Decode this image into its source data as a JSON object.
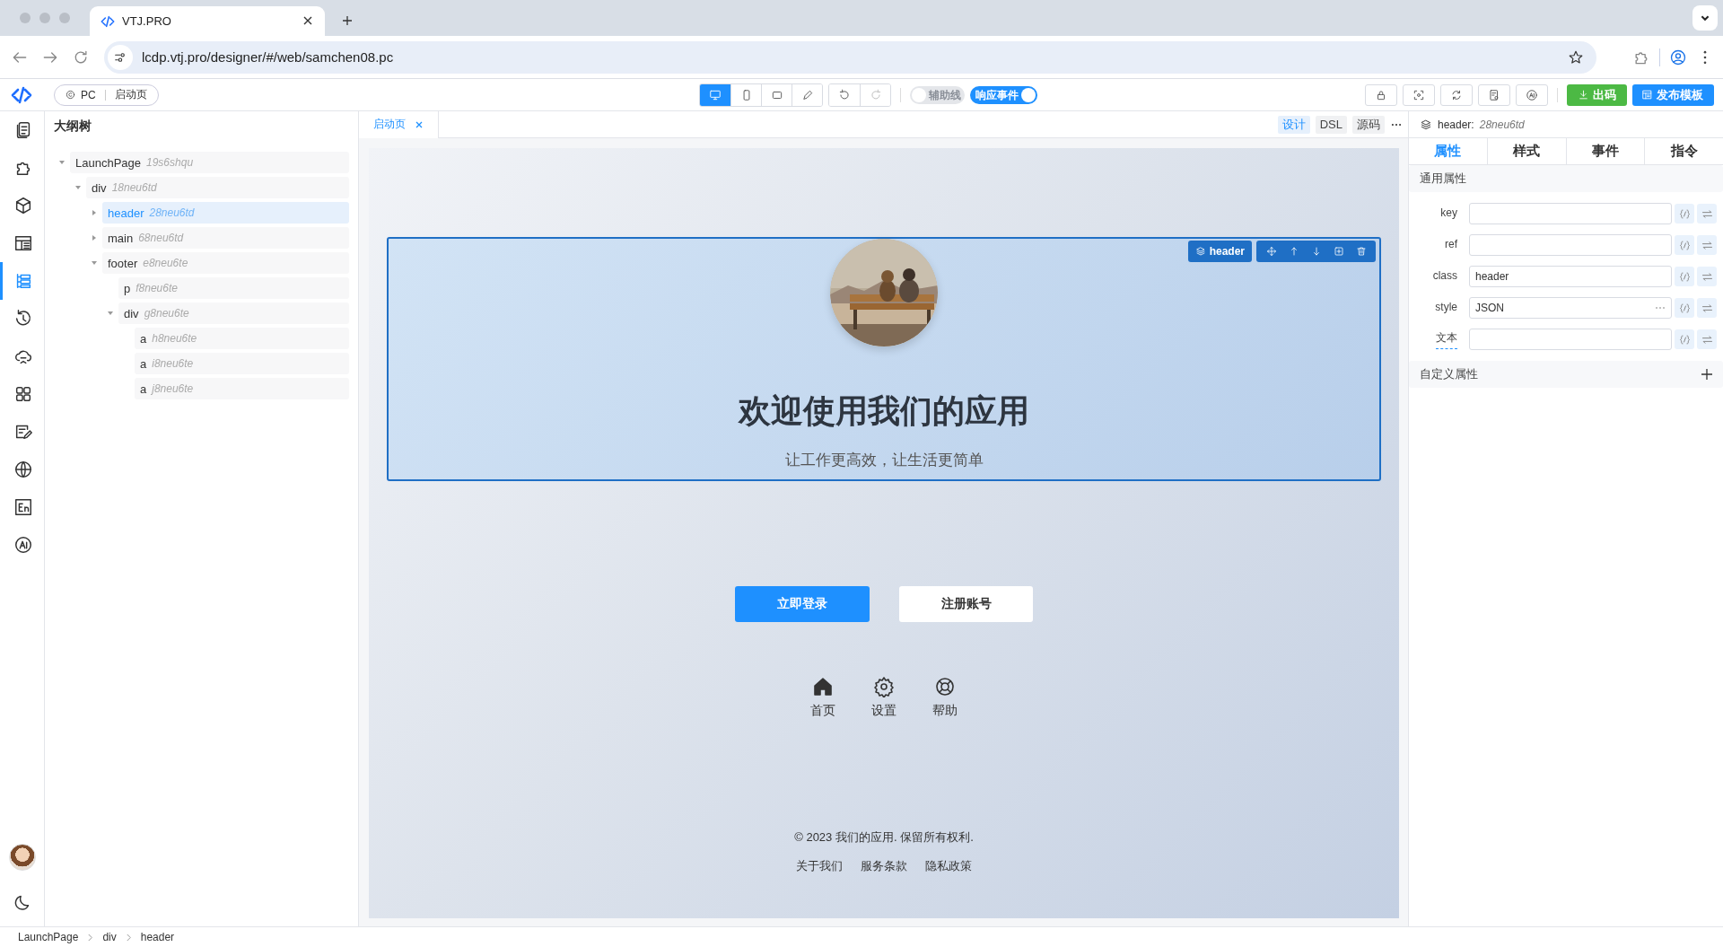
{
  "browser": {
    "tab_title": "VTJ.PRO",
    "url": "lcdp.vtj.pro/designer/#/web/samchen08.pc"
  },
  "toolbar": {
    "platform": "PC",
    "page": "启动页",
    "devices": [
      {
        "kind": "desktop",
        "selected": true
      },
      {
        "kind": "phone",
        "selected": false
      },
      {
        "kind": "tablet",
        "selected": false
      },
      {
        "kind": "pen",
        "selected": false
      }
    ],
    "history": [
      {
        "kind": "undo",
        "disabled": false
      },
      {
        "kind": "redo",
        "disabled": true
      }
    ],
    "toggles": [
      {
        "label": "辅助线",
        "on": false
      },
      {
        "label": "响应事件",
        "on": true
      }
    ],
    "tools": [
      {
        "kind": "lock"
      },
      {
        "kind": "preview"
      },
      {
        "kind": "refresh"
      },
      {
        "kind": "settings-doc"
      },
      {
        "kind": "ai"
      }
    ],
    "actions": [
      {
        "label": "出码",
        "kind": "export"
      },
      {
        "label": "发布模板",
        "kind": "publish"
      }
    ]
  },
  "sidebar": {
    "items": [
      {
        "kind": "pages",
        "selected": false
      },
      {
        "kind": "plugin",
        "selected": false
      },
      {
        "kind": "component",
        "selected": false
      },
      {
        "kind": "template",
        "selected": false
      },
      {
        "kind": "outline",
        "selected": true
      },
      {
        "kind": "history",
        "selected": false
      },
      {
        "kind": "api",
        "selected": false
      },
      {
        "kind": "apps",
        "selected": false
      },
      {
        "kind": "edit",
        "selected": false
      },
      {
        "kind": "globe",
        "selected": false
      },
      {
        "kind": "i18n",
        "selected": false
      },
      {
        "kind": "ai",
        "selected": false
      }
    ]
  },
  "outline": {
    "title": "大纲树",
    "tree": [
      {
        "name": "LaunchPage",
        "id": "19s6shqu",
        "expanded": true,
        "selected": false,
        "children": [
          {
            "name": "div",
            "id": "18neu6td",
            "expanded": true,
            "selected": false,
            "children": [
              {
                "name": "header",
                "id": "28neu6td",
                "expanded": false,
                "selected": true
              },
              {
                "name": "main",
                "id": "68neu6td",
                "expanded": false,
                "selected": false
              },
              {
                "name": "footer",
                "id": "e8neu6te",
                "expanded": true,
                "selected": false,
                "children": [
                  {
                    "name": "p",
                    "id": "f8neu6te",
                    "selected": false
                  },
                  {
                    "name": "div",
                    "id": "g8neu6te",
                    "expanded": true,
                    "selected": false,
                    "children": [
                      {
                        "name": "a",
                        "id": "h8neu6te",
                        "selected": false
                      },
                      {
                        "name": "a",
                        "id": "i8neu6te",
                        "selected": false
                      },
                      {
                        "name": "a",
                        "id": "j8neu6te",
                        "selected": false
                      }
                    ]
                  }
                ]
              }
            ]
          }
        ]
      }
    ]
  },
  "canvas": {
    "tabs": [
      {
        "label": "启动页",
        "selected": true
      }
    ],
    "views": [
      {
        "label": "设计",
        "selected": true
      },
      {
        "label": "DSL",
        "selected": false
      },
      {
        "label": "源码",
        "selected": false
      }
    ],
    "selection": {
      "label": "header",
      "tools": [
        {
          "kind": "move"
        },
        {
          "kind": "up"
        },
        {
          "kind": "down"
        },
        {
          "kind": "copy"
        },
        {
          "kind": "delete"
        }
      ]
    },
    "header": {
      "title": "欢迎使用我们的应用",
      "subtitle": "让工作更高效，让生活更简单"
    },
    "buttons": [
      {
        "label": "立即登录",
        "kind": "primary"
      },
      {
        "label": "注册账号",
        "kind": "default"
      }
    ],
    "nav": [
      {
        "label": "首页",
        "kind": "home"
      },
      {
        "label": "设置",
        "kind": "settings"
      },
      {
        "label": "帮助",
        "kind": "help"
      }
    ],
    "footer": {
      "copyright": "© 2023 我们的应用. 保留所有权利.",
      "links": [
        "关于我们",
        "服务条款",
        "隐私政策"
      ]
    }
  },
  "inspector": {
    "node_name": "header:",
    "node_id": "28neu6td",
    "tabs": [
      {
        "label": "属性",
        "selected": true
      },
      {
        "label": "样式",
        "selected": false
      },
      {
        "label": "事件",
        "selected": false
      },
      {
        "label": "指令",
        "selected": false
      }
    ],
    "section": "通用属性",
    "fields": [
      {
        "label": "key",
        "kind": "text",
        "hinted": false
      },
      {
        "label": "ref",
        "kind": "text",
        "hinted": false
      },
      {
        "label": "class",
        "value": "header",
        "kind": "text",
        "hinted": false
      },
      {
        "label": "style",
        "value": "JSON",
        "kind": "json",
        "hinted": false
      },
      {
        "label": "文本",
        "kind": "text",
        "hinted": true
      }
    ],
    "custom_section": "自定义属性"
  },
  "breadcrumb": [
    "LaunchPage",
    "div",
    "header"
  ]
}
